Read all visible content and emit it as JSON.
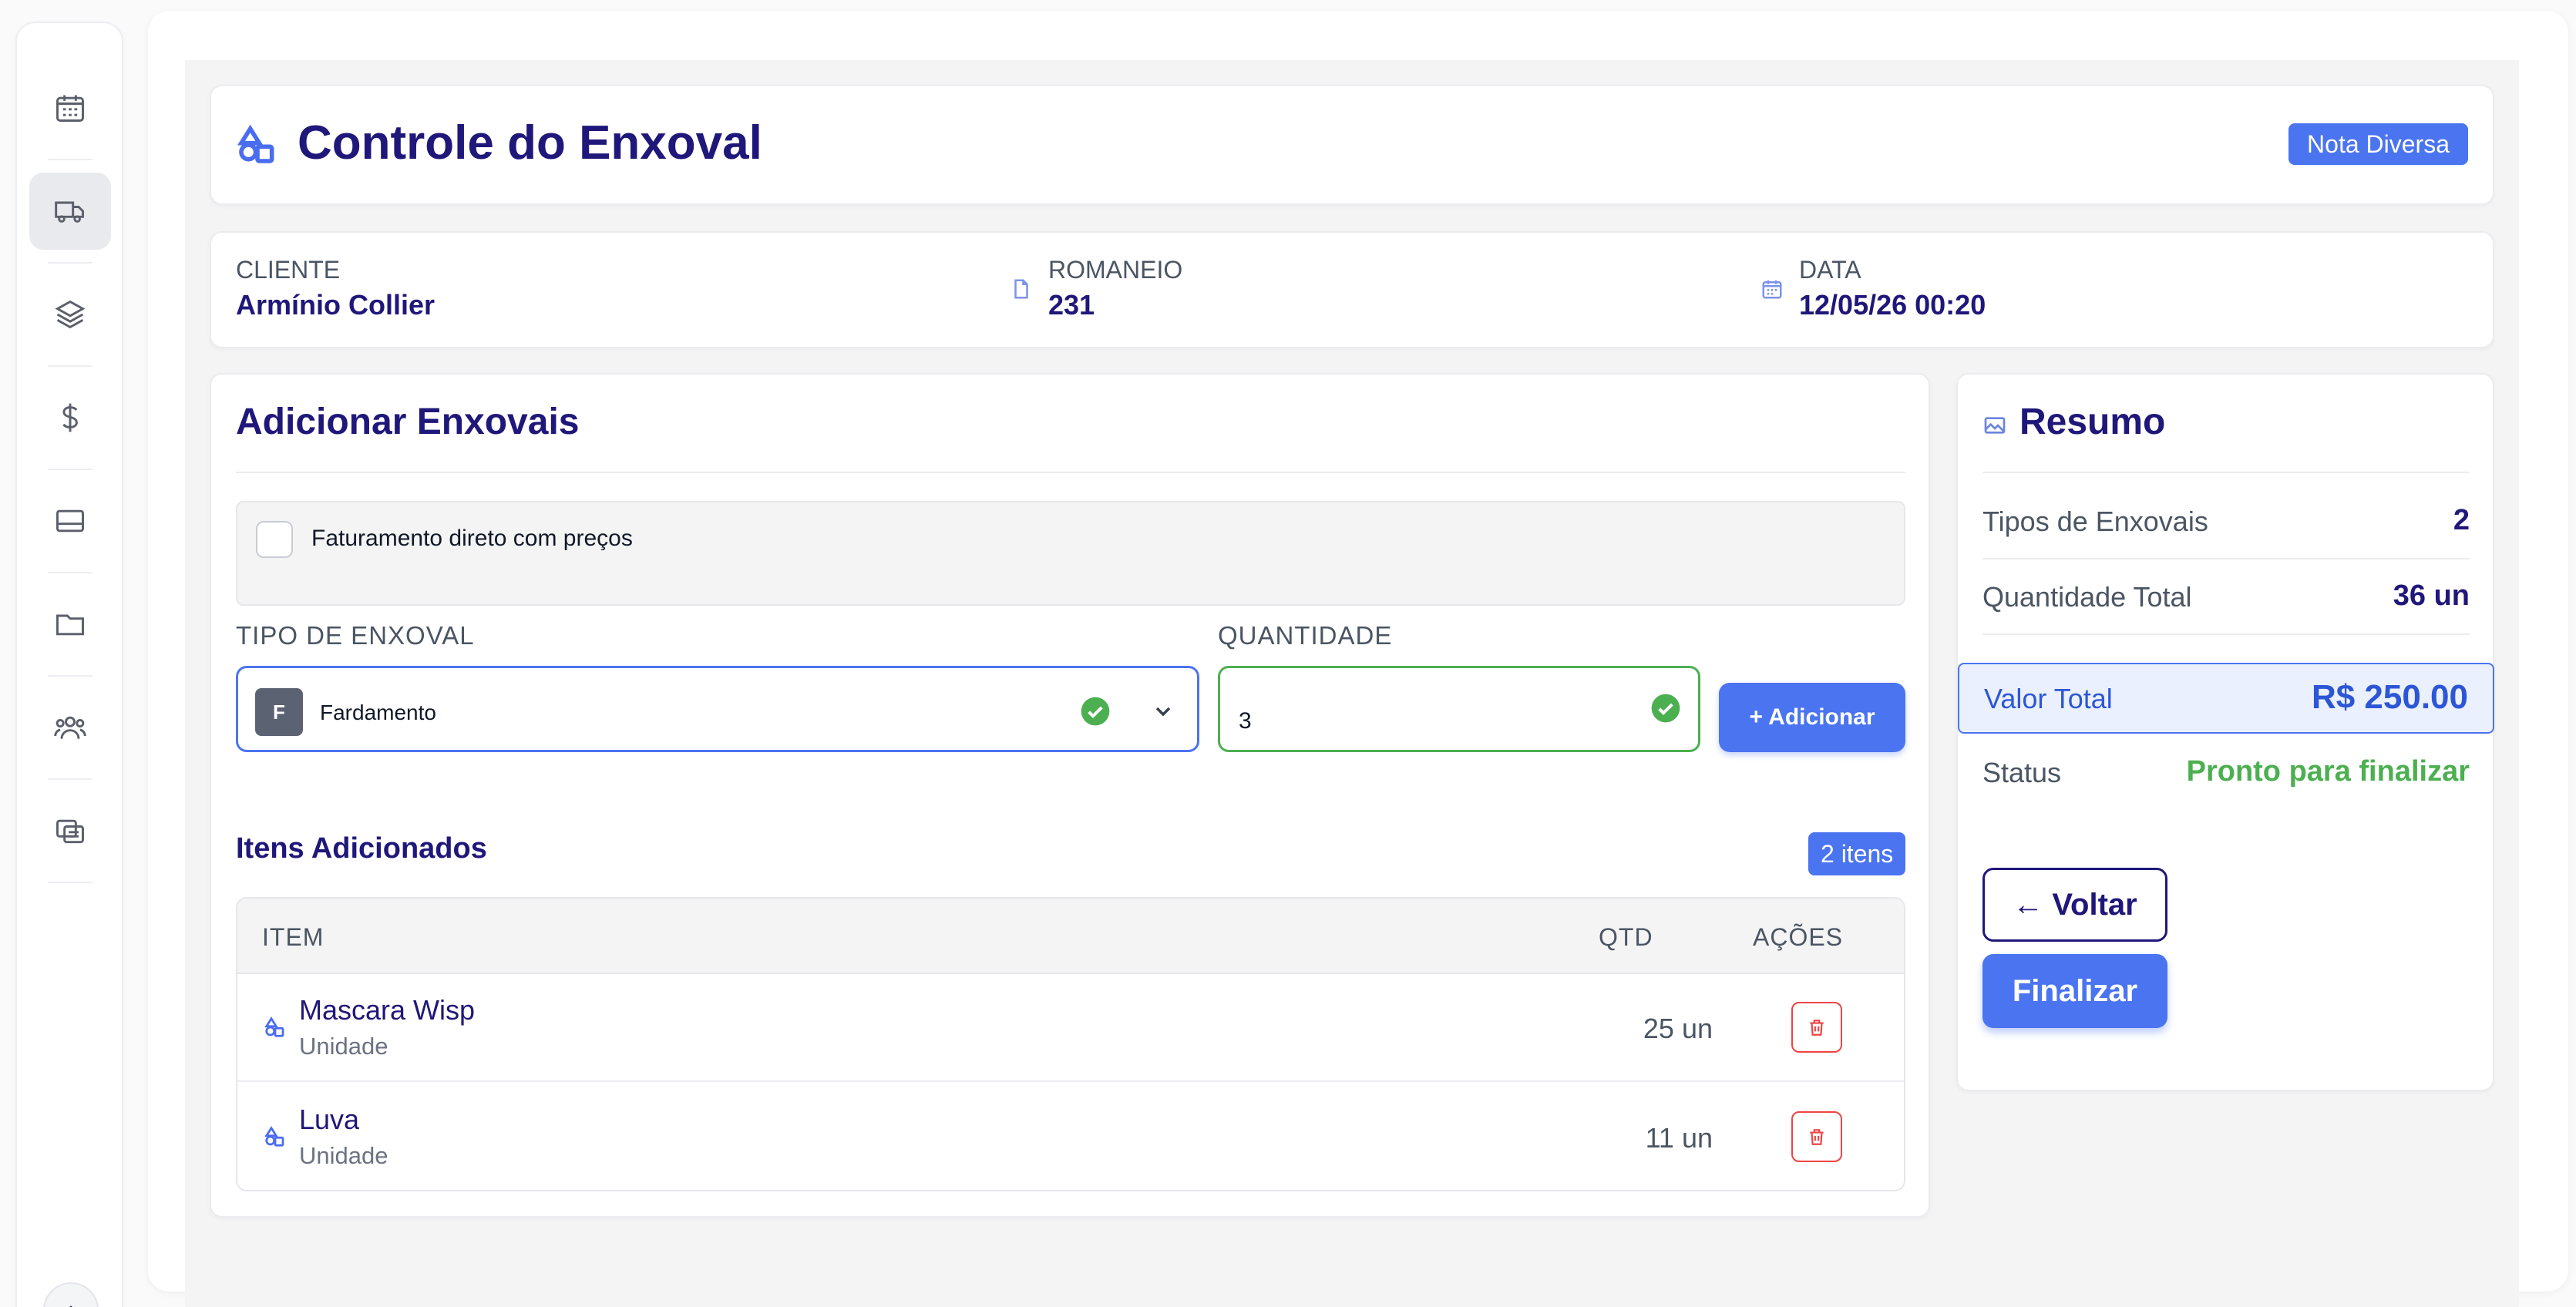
{
  "sidebar": {
    "items": [
      {
        "icon": "calendar-icon",
        "active": false
      },
      {
        "icon": "truck-icon",
        "active": true
      },
      {
        "icon": "layers-icon",
        "active": false
      },
      {
        "icon": "dollar-icon",
        "active": false
      },
      {
        "icon": "card-icon",
        "active": false
      },
      {
        "icon": "folder-icon",
        "active": false
      },
      {
        "icon": "users-icon",
        "active": false
      },
      {
        "icon": "docs-icon",
        "active": false
      }
    ]
  },
  "header": {
    "title": "Controle do Enxoval",
    "badge": "Nota Diversa"
  },
  "info": {
    "cliente_label": "CLIENTE",
    "cliente_value": "Armínio Collier",
    "romaneio_label": "ROMANEIO",
    "romaneio_value": "231",
    "data_label": "DATA",
    "data_value": "12/05/26 00:20"
  },
  "add": {
    "title": "Adicionar Enxovais",
    "billing_label": "Faturamento direto com preços",
    "tipo_label": "TIPO DE ENXOVAL",
    "tipo_avatar": "F",
    "tipo_value": "Fardamento",
    "qtd_label": "QUANTIDADE",
    "qtd_value": "3",
    "add_button": "+ Adicionar"
  },
  "items": {
    "title": "Itens Adicionados",
    "badge": "2 itens",
    "columns": [
      "ITEM",
      "QTD",
      "AÇÕES"
    ],
    "rows": [
      {
        "name": "Mascara Wisp",
        "unit": "Unidade",
        "qty": "25 un"
      },
      {
        "name": "Luva",
        "unit": "Unidade",
        "qty": "11 un"
      }
    ]
  },
  "summary": {
    "title": "Resumo",
    "tipos_label": "Tipos de Enxovais",
    "tipos_value": "2",
    "qtd_label": "Quantidade Total",
    "qtd_value": "36 un",
    "total_label": "Valor Total",
    "total_value": "R$ 250.00",
    "status_label": "Status",
    "status_value": "Pronto para finalizar",
    "back_button": "← Voltar",
    "finish_button": "Finalizar"
  },
  "colors": {
    "accent": "#4a74f0",
    "navy": "#20177a",
    "success": "#4caf50",
    "danger": "#ef4444"
  }
}
